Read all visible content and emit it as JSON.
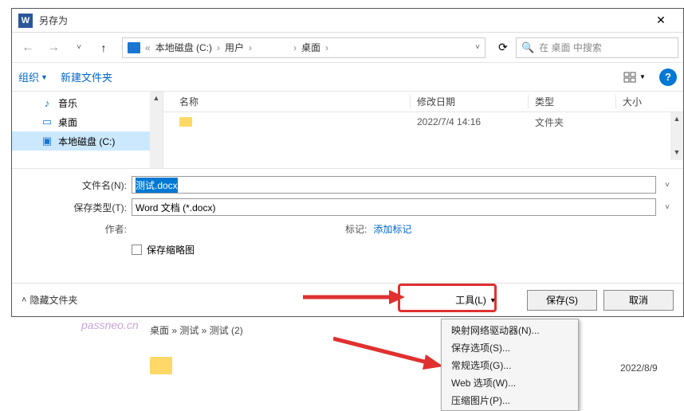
{
  "titlebar": {
    "title": "另存为",
    "app_glyph": "W"
  },
  "nav": {
    "crumbs": [
      "本地磁盘 (C:)",
      "用户",
      "",
      "桌面"
    ],
    "refresh_glyph": "⟳",
    "search_placeholder": "在 桌面 中搜索"
  },
  "toolbar": {
    "organize": "组织",
    "new_folder": "新建文件夹",
    "help_glyph": "?"
  },
  "sidebar": {
    "items": [
      {
        "icon": "♪",
        "color": "#1976d2",
        "label": "音乐"
      },
      {
        "icon": "▭",
        "color": "#1976d2",
        "label": "桌面"
      },
      {
        "icon": "▣",
        "color": "#1976d2",
        "label": "本地磁盘 (C:)"
      }
    ]
  },
  "list": {
    "columns": {
      "name": "名称",
      "date": "修改日期",
      "type": "类型",
      "size": "大小"
    },
    "rows": [
      {
        "name": "",
        "date": "2022/7/4 14:16",
        "type": "文件夹"
      }
    ]
  },
  "form": {
    "filename_label": "文件名(N):",
    "filename_value": "测试.docx",
    "filetype_label": "保存类型(T):",
    "filetype_value": "Word 文档 (*.docx)",
    "author_label": "作者:",
    "author_value": "",
    "tags_label": "标记:",
    "tags_link": "添加标记",
    "thumbnail": "保存缩略图"
  },
  "footer": {
    "hide_folders": "隐藏文件夹",
    "tools": "工具(L)",
    "save": "保存(S)",
    "cancel": "取消"
  },
  "menu": {
    "items": [
      "映射网络驱动器(N)...",
      "保存选项(S)...",
      "常规选项(G)...",
      "Web 选项(W)...",
      "压缩图片(P)..."
    ]
  },
  "background": {
    "crumb_trail": "桌面 » 测试 » 测试 (2)",
    "date": "2022/8/9"
  },
  "watermark": "passneo.cn"
}
